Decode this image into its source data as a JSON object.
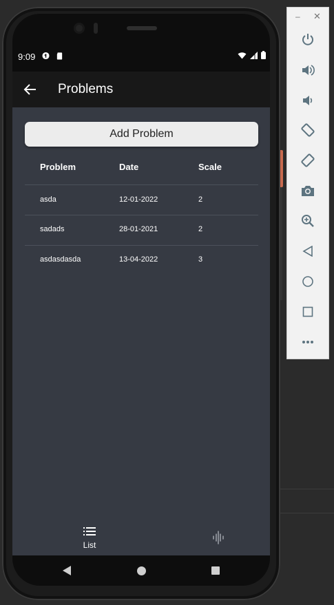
{
  "status_bar": {
    "time": "9:09"
  },
  "app_bar": {
    "title": "Problems"
  },
  "add_button": {
    "label": "Add Problem"
  },
  "table": {
    "headers": [
      "Problem",
      "Date",
      "Scale"
    ],
    "rows": [
      [
        "asda",
        "12-01-2022",
        "2"
      ],
      [
        "sadads",
        "28-01-2021",
        "2"
      ],
      [
        "asdasdasda",
        "13-04-2022",
        "3"
      ]
    ]
  },
  "bottom_nav": {
    "list_label": "List"
  },
  "colors": {
    "screen_bg": "#363a43",
    "appbar_bg": "#181818",
    "button_bg": "#ececec",
    "accent_side": "#c86a4f"
  },
  "toolbar": {
    "icons": [
      "power-icon",
      "volume-up-icon",
      "volume-down-icon",
      "rotate-left-icon",
      "rotate-right-icon",
      "camera-icon",
      "zoom-icon",
      "back-icon",
      "home-icon",
      "overview-icon",
      "more-icon"
    ]
  }
}
